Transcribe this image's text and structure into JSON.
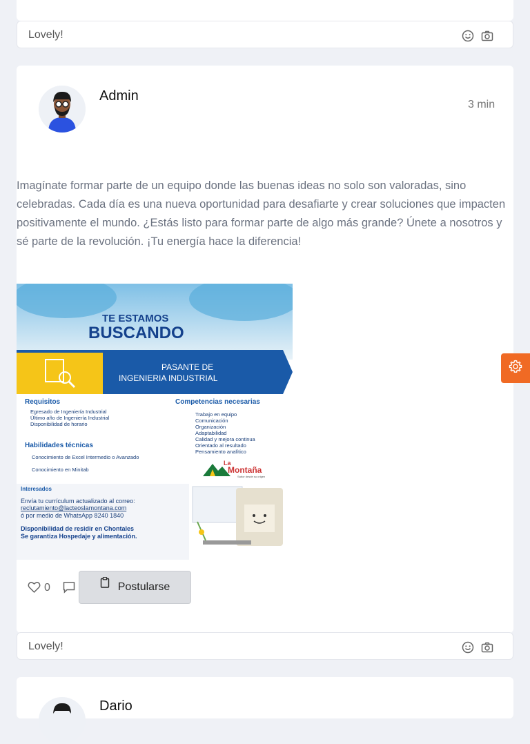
{
  "top_comment": {
    "text": "Lovely!"
  },
  "post": {
    "author": "Admin",
    "time": "3 min",
    "body": "Imagínate formar parte de un equipo donde las buenas ideas no solo son valoradas, sino celebradas. Cada día es una nueva oportunidad para desafiarte y crear soluciones que impacten positivamente el mundo. ¿Estás listo para formar parte de algo más grande? Únete a nosotros y sé parte de la revolución. ¡Tu energía hace la diferencia!",
    "likes": "0",
    "apply_label": "Postularse",
    "poster": {
      "headline1": "TE ESTAMOS",
      "headline2": "BUSCANDO",
      "role_line1": "PASANTE DE",
      "role_line2": "INGENIERIA INDUSTRIAL",
      "req_title": "Requisitos",
      "req_items": [
        "Egresado de Ingeniería Industrial",
        "Último año de Ingeniería Industrial",
        "Disponibilidad de horario"
      ],
      "skills_title": "Habilidades técnicas",
      "skills_items": [
        "Conocimiento de Excel Intermedio o Avanzado",
        "Conocimiento en Minitab"
      ],
      "comp_title": "Competencias necesarias",
      "comp_items": [
        "Trabajo en equipo",
        "Comunicación",
        "Organización",
        "Adaptabilidad",
        "Calidad y mejora continua",
        "Orientado al resultado",
        "Pensamiento analítico"
      ],
      "brand_la": "La",
      "brand_name": "Montaña",
      "brand_tagline": "Sabor desde su origen",
      "interest_title": "Interesados",
      "interest_line1": "Envía tu currículum actualizado al correo:",
      "interest_email": "reclutamiento@lacteoslamontana.com",
      "interest_line2": "ó por medio de WhatsApp 8240 1840",
      "note_line1": "Disponibilidad de residir en Chontales",
      "note_line2": "Se garantiza Hospedaje y alimentación."
    }
  },
  "comment_bar": {
    "text": "Lovely!"
  },
  "next_post": {
    "author": "Dario"
  },
  "icons": [
    "smile-icon",
    "camera-icon",
    "heart-icon",
    "comment-icon",
    "clipboard-icon",
    "gear-icon"
  ],
  "colors": {
    "accent": "#f06a24",
    "poster_blue": "#1a5aa8",
    "poster_yellow": "#f5c518"
  }
}
